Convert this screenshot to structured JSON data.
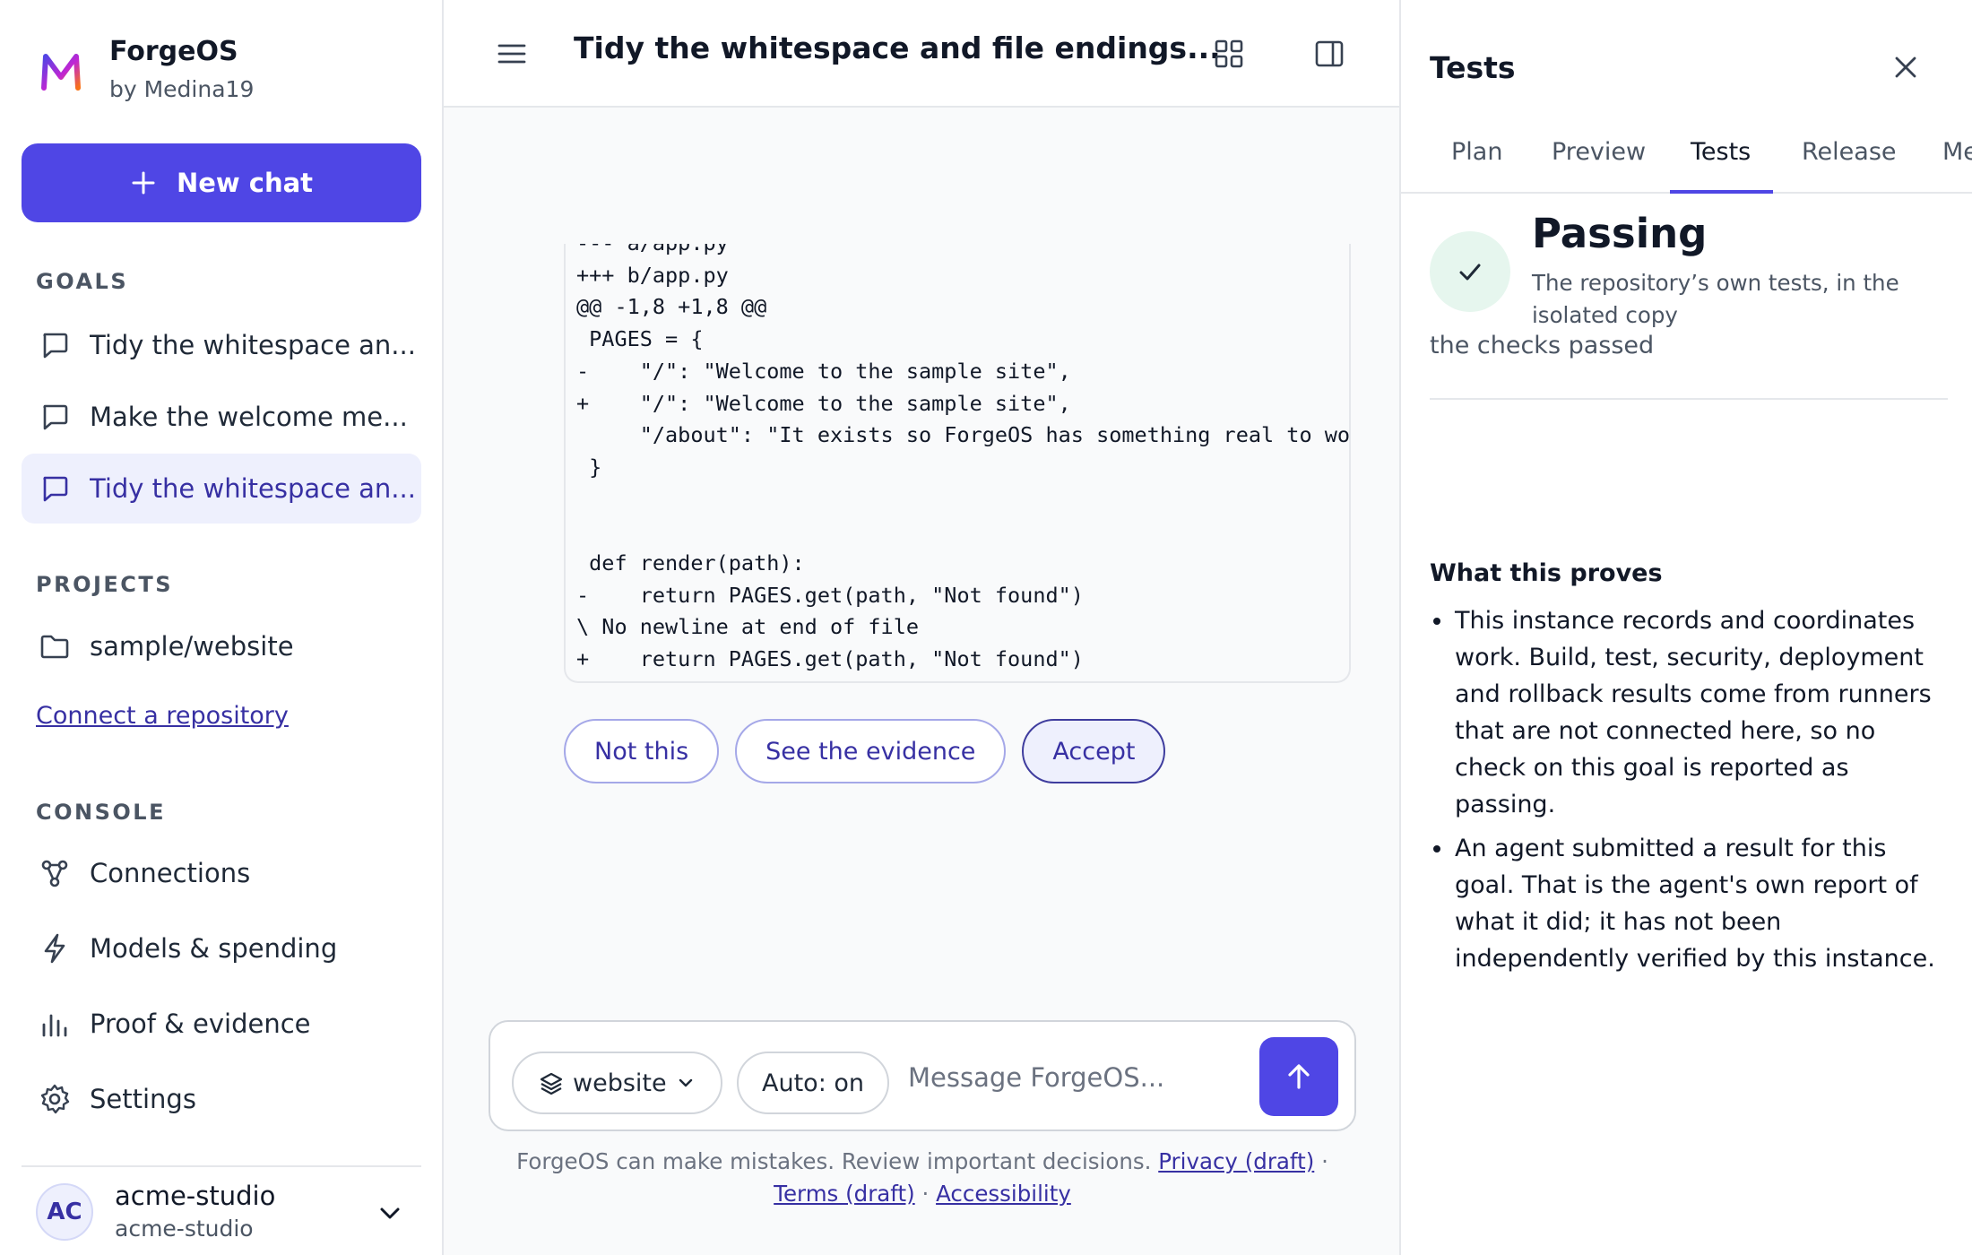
{
  "brand": {
    "name": "ForgeOS",
    "by": "by Medina19"
  },
  "new_chat_label": "New chat",
  "sidebar": {
    "goals_label": "GOALS",
    "goals": [
      {
        "label": "Tidy the whitespace an..."
      },
      {
        "label": "Make the welcome me..."
      },
      {
        "label": "Tidy the whitespace an..."
      }
    ],
    "projects_label": "PROJECTS",
    "projects": [
      {
        "label": "sample/website"
      }
    ],
    "connect_link": "Connect a repository",
    "console_label": "CONSOLE",
    "console": [
      {
        "label": "Connections",
        "icon": "connections-icon"
      },
      {
        "label": "Models & spending",
        "icon": "lightning-icon"
      },
      {
        "label": "Proof & evidence",
        "icon": "bar-chart-icon"
      },
      {
        "label": "Settings",
        "icon": "gear-icon"
      }
    ],
    "account": {
      "initials": "AC",
      "name": "acme-studio",
      "sub": "acme-studio"
    }
  },
  "main": {
    "title": "Tidy the whitespace and file endings...",
    "diff_text": "--- a/app.py\n+++ b/app.py\n@@ -1,8 +1,8 @@\n PAGES = {\n-    \"/\": \"Welcome to the sample site\",\n+    \"/\": \"Welcome to the sample site\",\n     \"/about\": \"It exists so ForgeOS has something real to wo\n }\n\n\n def render(path):\n-    return PAGES.get(path, \"Not found\")\n\\ No newline at end of file\n+    return PAGES.get(path, \"Not found\")",
    "actions": {
      "reject": "Not this",
      "evidence": "See the evidence",
      "accept": "Accept"
    },
    "composer": {
      "repo": "website",
      "auto": "Auto: on",
      "placeholder": "Message ForgeOS..."
    },
    "disclaimer": {
      "text": "ForgeOS can make mistakes. Review important decisions.",
      "privacy": "Privacy (draft)",
      "sep": "·",
      "terms": "Terms (draft)",
      "accessibility": "Accessibility"
    }
  },
  "panel": {
    "title": "Tests",
    "tabs": [
      "Plan",
      "Preview",
      "Tests",
      "Release",
      "Me"
    ],
    "active_tab": "Tests",
    "status": {
      "title": "Passing",
      "description": "The repository’s own tests, in the isolated copy",
      "note": "the checks passed"
    },
    "proves_title": "What this proves",
    "proves": [
      "This instance records and coordinates work. Build, test, security, deployment and rollback results come from runners that are not connected here, so no check on this goal is reported as passing.",
      "An agent submitted a result for this goal. That is the agent's own report of what it did; it has not been independently verified by this instance."
    ]
  },
  "colors": {
    "accent": "#4f46e5",
    "accent_text": "#3730a3",
    "active_bg": "#eef0fd",
    "success_bg": "#e6f6ee",
    "success": "#1f2937"
  }
}
